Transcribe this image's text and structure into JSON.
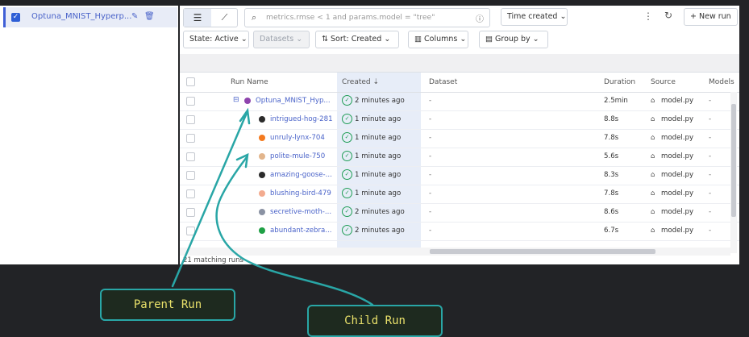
{
  "sidebar": {
    "experiment_name": "Optuna_MNIST_Hyperp...",
    "edit_icon": "pencil-icon",
    "delete_icon": "trash-icon"
  },
  "toolbar": {
    "view_list_icon": "list-icon",
    "view_chart_icon": "chart-icon",
    "search_placeholder": "metrics.rmse < 1 and params.model = \"tree\"",
    "time_filter": "Time created",
    "new_run": "New run",
    "state": "State: Active",
    "datasets": "Datasets",
    "sort": "Sort: Created",
    "columns": "Columns",
    "group_by": "Group by"
  },
  "table": {
    "headers": [
      "Run Name",
      "Created",
      "Dataset",
      "Duration",
      "Source",
      "Models"
    ],
    "rows": [
      {
        "name": "Optuna_MNIST_Hyp...",
        "dot": "#8e44ad",
        "created": "2 minutes ago",
        "dataset": "-",
        "duration": "2.5min",
        "source": "model.py",
        "models": "-",
        "parent": true
      },
      {
        "name": "intrigued-hog-281",
        "dot": "#2b2b2b",
        "created": "1 minute ago",
        "dataset": "-",
        "duration": "8.8s",
        "source": "model.py",
        "models": "-",
        "parent": false
      },
      {
        "name": "unruly-lynx-704",
        "dot": "#f47a1f",
        "created": "1 minute ago",
        "dataset": "-",
        "duration": "7.8s",
        "source": "model.py",
        "models": "-",
        "parent": false
      },
      {
        "name": "polite-mule-750",
        "dot": "#e2b58c",
        "created": "1 minute ago",
        "dataset": "-",
        "duration": "5.6s",
        "source": "model.py",
        "models": "-",
        "parent": false
      },
      {
        "name": "amazing-goose-...",
        "dot": "#2b2b2b",
        "created": "1 minute ago",
        "dataset": "-",
        "duration": "8.3s",
        "source": "model.py",
        "models": "-",
        "parent": false
      },
      {
        "name": "blushing-bird-479",
        "dot": "#f3ab8f",
        "created": "1 minute ago",
        "dataset": "-",
        "duration": "7.8s",
        "source": "model.py",
        "models": "-",
        "parent": false
      },
      {
        "name": "secretive-moth-...",
        "dot": "#8a92a3",
        "created": "2 minutes ago",
        "dataset": "-",
        "duration": "8.6s",
        "source": "model.py",
        "models": "-",
        "parent": false
      },
      {
        "name": "abundant-zebra...",
        "dot": "#1fa045",
        "created": "2 minutes ago",
        "dataset": "-",
        "duration": "6.7s",
        "source": "model.py",
        "models": "-",
        "parent": false
      }
    ]
  },
  "status_text": "21 matching runs",
  "annotations": {
    "parent_label": "Parent Run",
    "child_label": "Child Run",
    "color": "#29a6a6"
  }
}
